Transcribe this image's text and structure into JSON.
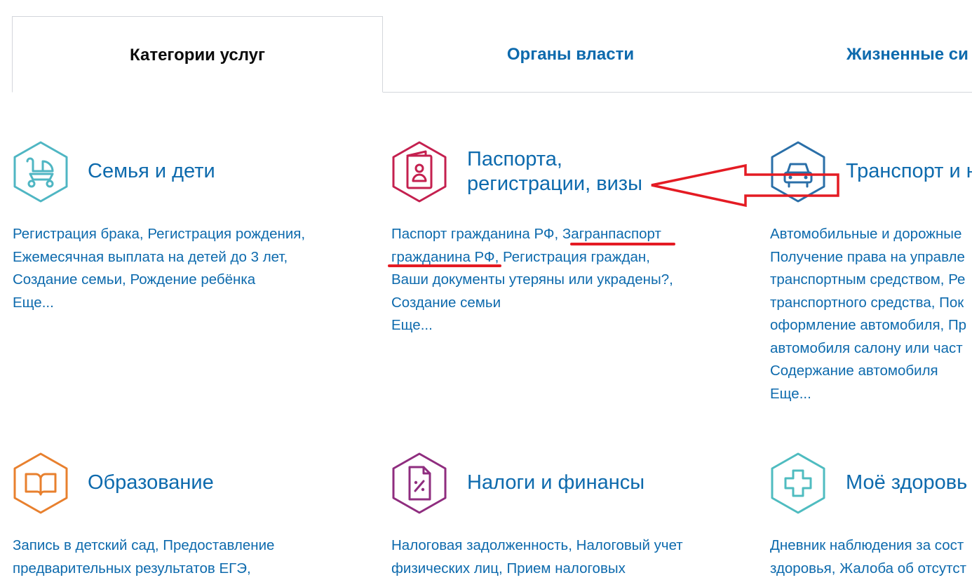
{
  "tabs": [
    {
      "label": "Категории услуг",
      "active": true
    },
    {
      "label": "Органы власти",
      "active": false
    },
    {
      "label": "Жизненные си",
      "active": false
    }
  ],
  "categories": [
    {
      "icon": "stroller-icon",
      "color": "#4fb6c3",
      "title_line1": "Семья и дети",
      "links": [
        [
          "Регистрация брака",
          ", ",
          "Регистрация рождения",
          ","
        ],
        [
          "Ежемесячная выплата на детей до 3 лет",
          ","
        ],
        [
          "Создание семьи",
          ", ",
          "Рождение ребёнка"
        ],
        [
          "Еще..."
        ]
      ]
    },
    {
      "icon": "passport-icon",
      "color": "#c4204f",
      "title_line1": "Паспорта,",
      "title_line2": "регистрации, визы",
      "links": [
        [
          "Паспорт гражданина РФ",
          ", ",
          "Загранпаспорт"
        ],
        [
          "гражданина РФ",
          ", ",
          "Регистрация граждан",
          ","
        ],
        [
          "Ваши документы утеряны или украдены?",
          ","
        ],
        [
          "Создание семьи"
        ],
        [
          "Еще..."
        ]
      ]
    },
    {
      "icon": "car-icon",
      "color": "#2a6fa8",
      "title_line1": "Транспорт и н",
      "links": [
        [
          "Автомобильные и дорожные"
        ],
        [
          "Получение права на управле"
        ],
        [
          "транспортным средством, Ре"
        ],
        [
          "транспортного средства, Пок"
        ],
        [
          "оформление автомобиля, Пр"
        ],
        [
          "автомобиля салону или част"
        ],
        [
          "Содержание автомобиля"
        ],
        [
          "Еще..."
        ]
      ]
    },
    {
      "icon": "book-icon",
      "color": "#e8802e",
      "title_line1": "Образование",
      "links": [
        [
          "Запись в детский сад",
          ", ",
          "Предоставление"
        ],
        [
          "предварительных результатов ЕГЭ",
          ","
        ]
      ]
    },
    {
      "icon": "tax-document-icon",
      "color": "#8f2d7f",
      "title_line1": "Налоги и финансы",
      "links": [
        [
          "Налоговая задолженность",
          ", ",
          "Налоговый учет"
        ],
        [
          "физических лиц",
          ", ",
          "Прием налоговых"
        ]
      ]
    },
    {
      "icon": "medical-cross-icon",
      "color": "#4fbcc0",
      "title_line1": "Моё здоровь",
      "links": [
        [
          "Дневник наблюдения за сост"
        ],
        [
          "здоровья",
          ", ",
          "Жалоба об отсутст"
        ]
      ]
    }
  ],
  "annotation": {
    "color": "#e41b23",
    "type": "arrow-pointing-left"
  }
}
